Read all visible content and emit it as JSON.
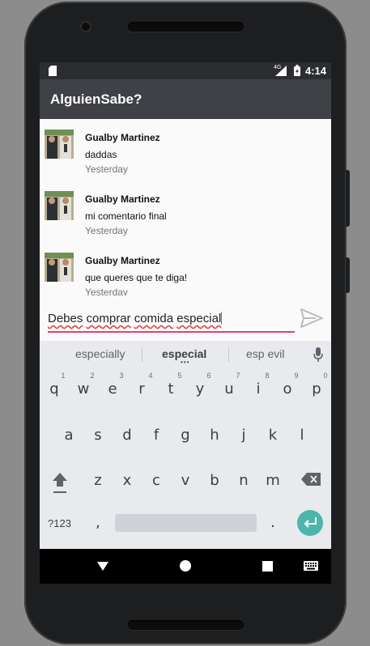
{
  "status_bar": {
    "network": "4G",
    "time": "4:14"
  },
  "app_bar": {
    "title": "AlguienSabe?"
  },
  "comments": [
    {
      "author": "Gualby Martinez",
      "text": "daddas",
      "date": "Yesterday"
    },
    {
      "author": "Gualby Martinez",
      "text": "mi comentario final",
      "date": "Yesterday"
    },
    {
      "author": "Gualby Martinez",
      "text": "que queres que te diga!",
      "date": "Yesterday"
    }
  ],
  "composer": {
    "words": [
      "Debes",
      "comprar",
      "comida",
      "especial"
    ],
    "send_icon": "send-icon"
  },
  "suggestions": [
    "especially",
    "especial",
    "esp evil"
  ],
  "keyboard": {
    "row1": [
      "q",
      "w",
      "e",
      "r",
      "t",
      "y",
      "u",
      "i",
      "o",
      "p"
    ],
    "row1_hints": [
      "1",
      "2",
      "3",
      "4",
      "5",
      "6",
      "7",
      "8",
      "9",
      "0"
    ],
    "row2": [
      "a",
      "s",
      "d",
      "f",
      "g",
      "h",
      "j",
      "k",
      "l"
    ],
    "row3": [
      "z",
      "x",
      "c",
      "v",
      "b",
      "n",
      "m"
    ],
    "symbols_label": "?123",
    "comma": ",",
    "period": "."
  },
  "colors": {
    "status_bar": "#2b2d31",
    "app_bar": "#3f4146",
    "accent": "#e0437a",
    "enter_key": "#4db6ac"
  }
}
